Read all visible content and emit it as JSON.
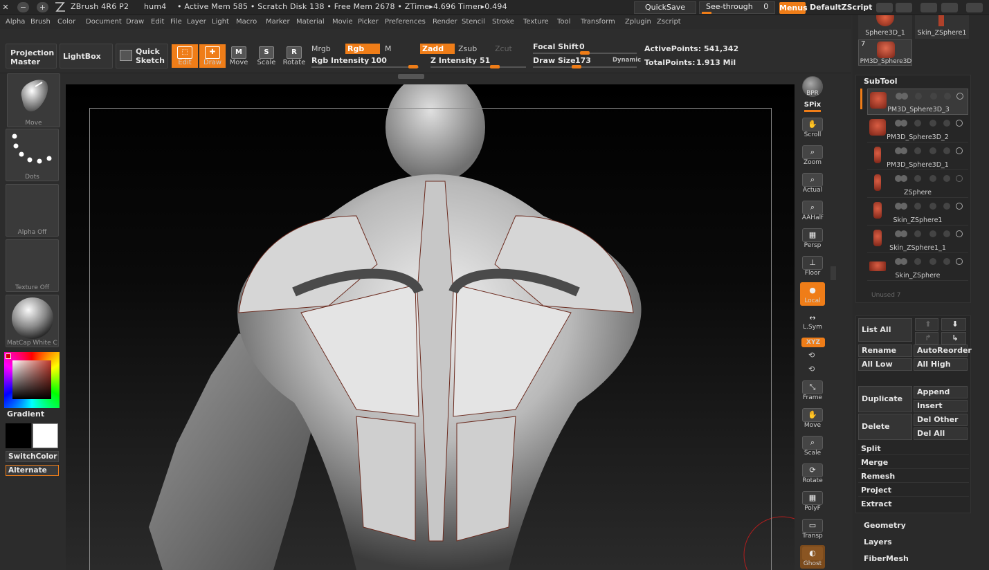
{
  "titlebar": {
    "app": "ZBrush 4R6 P2",
    "doc": "hum4",
    "stats": "• Active Mem 585 • Scratch Disk 138 • Free Mem 2678 • ZTime▸4.696 Timer▸0.494",
    "quicksave": "QuickSave",
    "seethrough": "See-through",
    "seethrough_value": "0",
    "menus": "Menus",
    "script": "DefaultZScript"
  },
  "menubar": [
    "Alpha",
    "Brush",
    "Color",
    "Document",
    "Draw",
    "Edit",
    "File",
    "Layer",
    "Light",
    "Macro",
    "Marker",
    "Material",
    "Movie",
    "Picker",
    "Preferences",
    "Render",
    "Stencil",
    "Stroke",
    "Texture",
    "Tool",
    "Transform",
    "Zplugin",
    "Zscript"
  ],
  "toolbar": {
    "projection_master": [
      "Projection",
      "Master"
    ],
    "lightbox": "LightBox",
    "quick_sketch": [
      "Quick",
      "Sketch"
    ],
    "tools": [
      {
        "label": "Edit",
        "icon": "edit-icon",
        "active": true
      },
      {
        "label": "Draw",
        "icon": "draw-icon",
        "active": true
      },
      {
        "label": "Move",
        "icon": "move-icon",
        "active": false
      },
      {
        "label": "Scale",
        "icon": "scale-icon",
        "active": false
      },
      {
        "label": "Rotate",
        "icon": "rotate-icon",
        "active": false
      }
    ],
    "mrgb": "Mrgb",
    "rgb": "Rgb",
    "m": "M",
    "zadd": "Zadd",
    "zsub": "Zsub",
    "zcut": "Zcut",
    "rgb_intensity_label": "Rgb Intensity",
    "rgb_intensity": "100",
    "z_intensity_label": "Z Intensity",
    "z_intensity": "51",
    "focal_shift_label": "Focal Shift",
    "focal_shift": "0",
    "draw_size_label": "Draw Size",
    "draw_size": "173",
    "dynamic": "Dynamic",
    "active_points_label": "ActivePoints:",
    "active_points": "541,342",
    "total_points_label": "TotalPoints:",
    "total_points": "1.913 Mil"
  },
  "left": {
    "brush": "Move",
    "stroke": "Dots",
    "alpha": "Alpha  Off",
    "texture": "Texture  Off",
    "material": "MatCap  White  C",
    "gradient": "Gradient",
    "switchcolor": "SwitchColor",
    "alternate": "Alternate"
  },
  "nav": [
    {
      "label": "BPR",
      "icon": "bpr-icon"
    },
    {
      "label": "SPix",
      "icon": "spix-icon"
    },
    {
      "label": "Scroll",
      "icon": "scroll-icon"
    },
    {
      "label": "Zoom",
      "icon": "zoom-icon"
    },
    {
      "label": "Actual",
      "icon": "actual-icon"
    },
    {
      "label": "AAHalf",
      "icon": "aahalf-icon"
    },
    {
      "label": "Persp",
      "icon": "persp-icon"
    },
    {
      "label": "Floor",
      "icon": "floor-icon"
    },
    {
      "label": "Local",
      "icon": "local-icon"
    },
    {
      "label": "L.Sym",
      "icon": "lsym-icon"
    },
    {
      "label": "XYZ",
      "icon": "xyz-icon"
    },
    {
      "label": "Frame",
      "icon": "frame-icon"
    },
    {
      "label": "Move",
      "icon": "move-nav-icon"
    },
    {
      "label": "Scale",
      "icon": "scale-nav-icon"
    },
    {
      "label": "Rotate",
      "icon": "rotate-nav-icon"
    },
    {
      "label": "PolyF",
      "icon": "polyf-icon"
    },
    {
      "label": "Transp",
      "icon": "transp-icon"
    },
    {
      "label": "Ghost",
      "icon": "ghost-icon"
    }
  ],
  "right": {
    "top_tools": [
      "Sphere3D_1",
      "Skin_ZSphere1"
    ],
    "top_tool_count": "7",
    "top_tool_3": "PM3D_Sphere3D",
    "subtool_title": "SubTool",
    "subtools": [
      "PM3D_Sphere3D_3",
      "PM3D_Sphere3D_2",
      "PM3D_Sphere3D_1",
      "ZSphere",
      "Skin_ZSphere1",
      "Skin_ZSphere1_1",
      "Skin_ZSphere"
    ],
    "unused": "Unused  7",
    "list_all": "List All",
    "rename": "Rename",
    "autoreorder": "AutoReorder",
    "all_low": "All Low",
    "all_high": "All High",
    "duplicate": "Duplicate",
    "append": "Append",
    "insert": "Insert",
    "delete": "Delete",
    "del_other": "Del Other",
    "del_all": "Del All",
    "split": "Split",
    "merge": "Merge",
    "remesh": "Remesh",
    "project": "Project",
    "extract": "Extract",
    "geometry": "Geometry",
    "layers": "Layers",
    "fibermesh": "FiberMesh"
  },
  "colors": {
    "accent": "#ef7d18",
    "panel": "#2c2c2c",
    "subtool_icon": "#c8452e"
  }
}
